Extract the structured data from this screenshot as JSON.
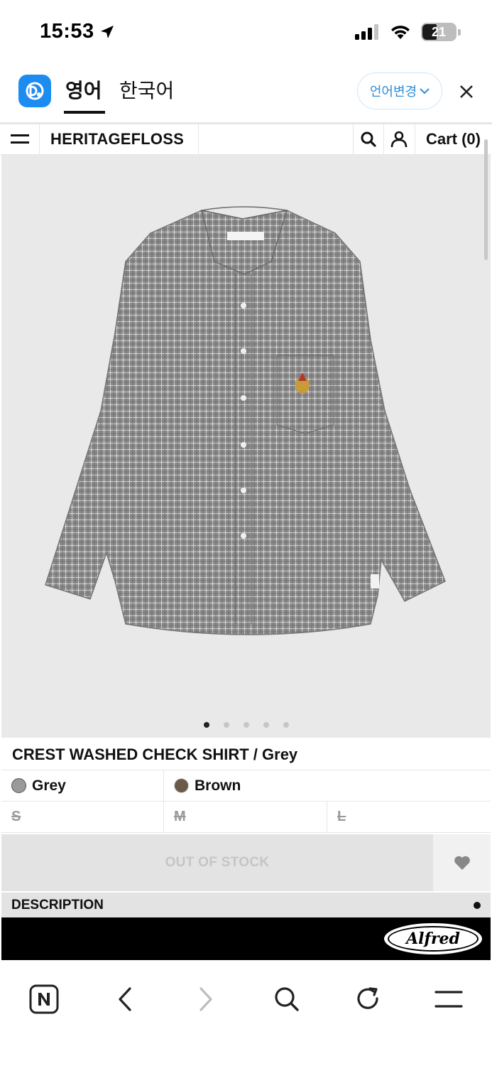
{
  "status_bar": {
    "time": "15:53",
    "battery": "21"
  },
  "translate_bar": {
    "active_lang": "영어",
    "other_lang": "한국어",
    "change_label": "언어변경"
  },
  "site_nav": {
    "brand": "HERITAGEFLOSS",
    "cart": "Cart (0)"
  },
  "product": {
    "title": "CREST WASHED CHECK SHIRT / Grey",
    "image_count": 5,
    "active_image": 1,
    "colors": [
      {
        "name": "Grey",
        "swatch": "#9a9a9a"
      },
      {
        "name": "Brown",
        "swatch": "#6b5a4a"
      }
    ],
    "sizes": [
      "S",
      "M",
      "L"
    ],
    "stock_label": "OUT OF STOCK",
    "description_label": "DESCRIPTION"
  },
  "ad": {
    "logo_text": "Alfred"
  },
  "colors": {
    "papago_blue": "#1d8cf0",
    "lang_change_text": "#2d8fdc",
    "out_of_stock_bg": "#e3e3e3",
    "shirt_grey": "#8e8e8e"
  }
}
